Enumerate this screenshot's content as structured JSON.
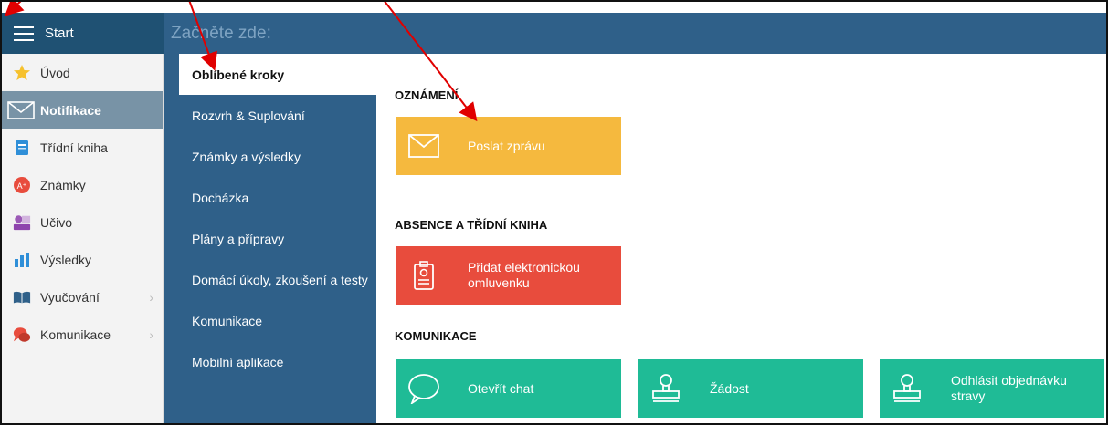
{
  "header": {
    "start_label": "Start",
    "page_heading": "Začněte zde:"
  },
  "sidebar": {
    "items": [
      {
        "label": "Úvod",
        "icon": "star-icon"
      },
      {
        "label": "Notifikace",
        "icon": "envelope-icon",
        "active": true
      },
      {
        "label": "Třídní kniha",
        "icon": "book-icon"
      },
      {
        "label": "Známky",
        "icon": "grade-badge-icon"
      },
      {
        "label": "Učivo",
        "icon": "teacher-icon"
      },
      {
        "label": "Výsledky",
        "icon": "bar-chart-icon"
      },
      {
        "label": "Vyučování",
        "icon": "open-book-icon",
        "expandable": true
      },
      {
        "label": "Komunikace",
        "icon": "chat-bubbles-icon",
        "expandable": true
      }
    ],
    "chevron": "›"
  },
  "categories": [
    {
      "label": "Oblíbené kroky",
      "active": true
    },
    {
      "label": "Rozvrh & Suplování"
    },
    {
      "label": "Známky a výsledky"
    },
    {
      "label": "Docházka"
    },
    {
      "label": "Plány a přípravy"
    },
    {
      "label": "Domácí úkoly, zkoušení a testy"
    },
    {
      "label": "Komunikace"
    },
    {
      "label": "Mobilní aplikace"
    }
  ],
  "sections": {
    "announcements": {
      "title": "OZNÁMENÍ",
      "tiles": [
        {
          "label": "Poslat zprávu",
          "icon": "envelope-outline-icon",
          "color": "#f5b93e"
        }
      ]
    },
    "absence": {
      "title": "ABSENCE A TŘÍDNÍ KNIHA",
      "tiles": [
        {
          "label": "Přidat elektronickou omluvenku",
          "icon": "id-badge-icon",
          "color": "#e84c3d"
        }
      ]
    },
    "communication": {
      "title": "KOMUNIKACE",
      "tiles": [
        {
          "label": "Otevřít chat",
          "icon": "speech-bubble-icon",
          "color": "#1fbb96"
        },
        {
          "label": "Žádost",
          "icon": "stamp-icon",
          "color": "#1fbb96"
        },
        {
          "label": "Odhlásit objednávku stravy",
          "icon": "stamp-icon",
          "color": "#1fbb96"
        }
      ]
    }
  },
  "colors": {
    "topbar": "#2f6089",
    "topbar_left": "#1f5173",
    "sidebar_active": "#7893a6",
    "annotation_arrow": "#e00000"
  }
}
